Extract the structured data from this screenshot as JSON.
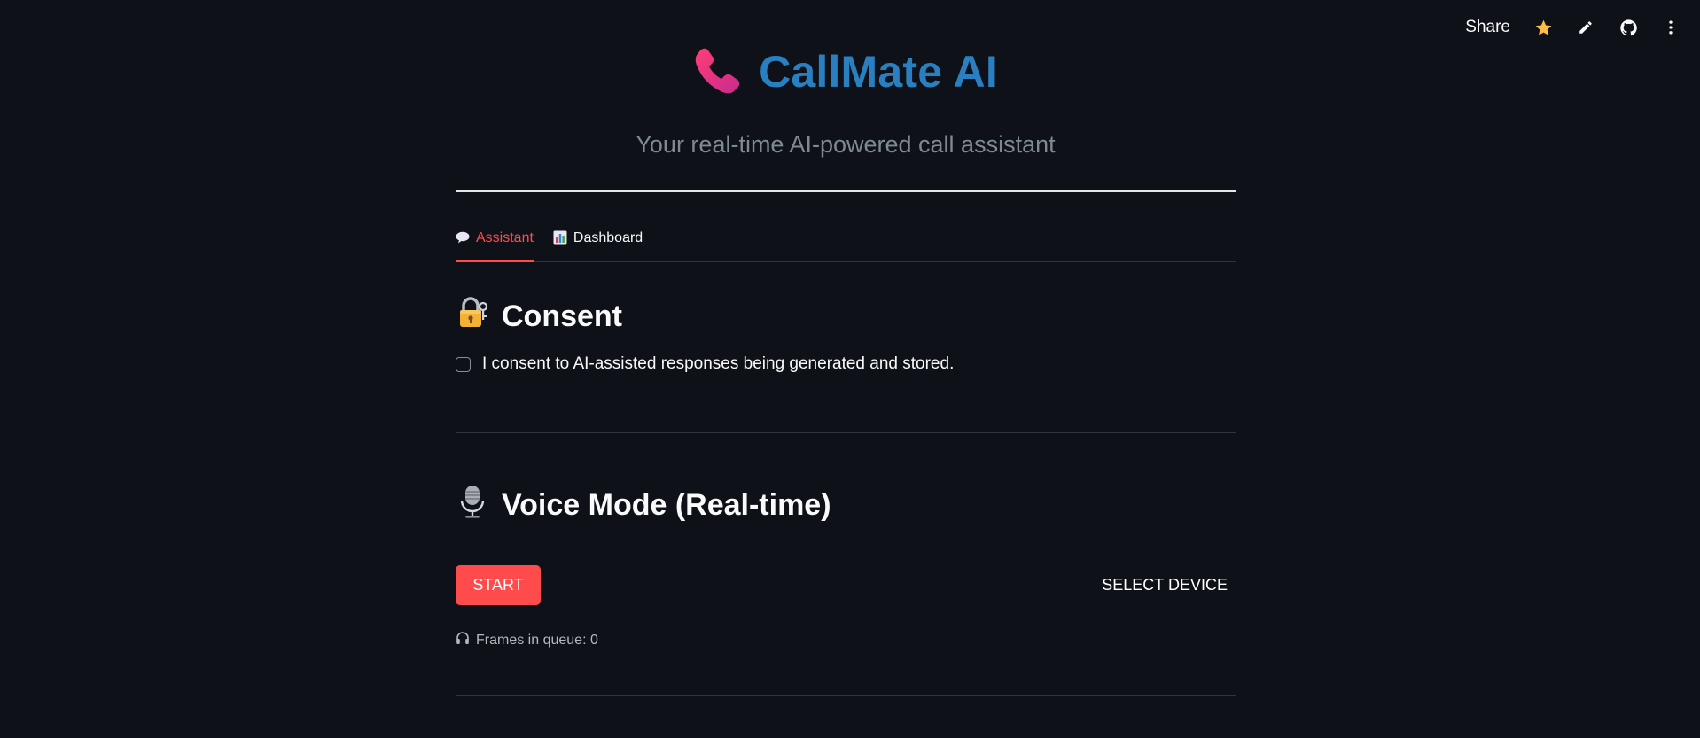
{
  "toolbar": {
    "share_label": "Share",
    "icons": [
      "star-icon",
      "pencil-icon",
      "github-icon",
      "more-vert-icon"
    ],
    "star_color": "#ffbd45"
  },
  "header": {
    "title": "CallMate AI",
    "title_icon": "telephone-icon",
    "subtitle": "Your real-time AI-powered call assistant"
  },
  "tabs": [
    {
      "label": "Assistant",
      "icon": "speech-balloon-icon",
      "active": true
    },
    {
      "label": "Dashboard",
      "icon": "bar-chart-icon",
      "active": false
    }
  ],
  "consent": {
    "title": "Consent",
    "icon": "lock-with-key-icon",
    "checkbox_label": "I consent to AI-assisted responses being generated and stored.",
    "checked": false
  },
  "voice": {
    "title": "Voice Mode (Real-time)",
    "icon": "microphone-icon",
    "start_label": "START",
    "select_device_label": "SELECT DEVICE",
    "frames_text": "Frames in queue: 0",
    "frames_icon": "headphones-icon"
  },
  "colors": {
    "background": "#0e1117",
    "accent": "#ff4b4b",
    "title_blue": "#2a7fc0",
    "subtitle_gray": "#7f8a8f"
  }
}
